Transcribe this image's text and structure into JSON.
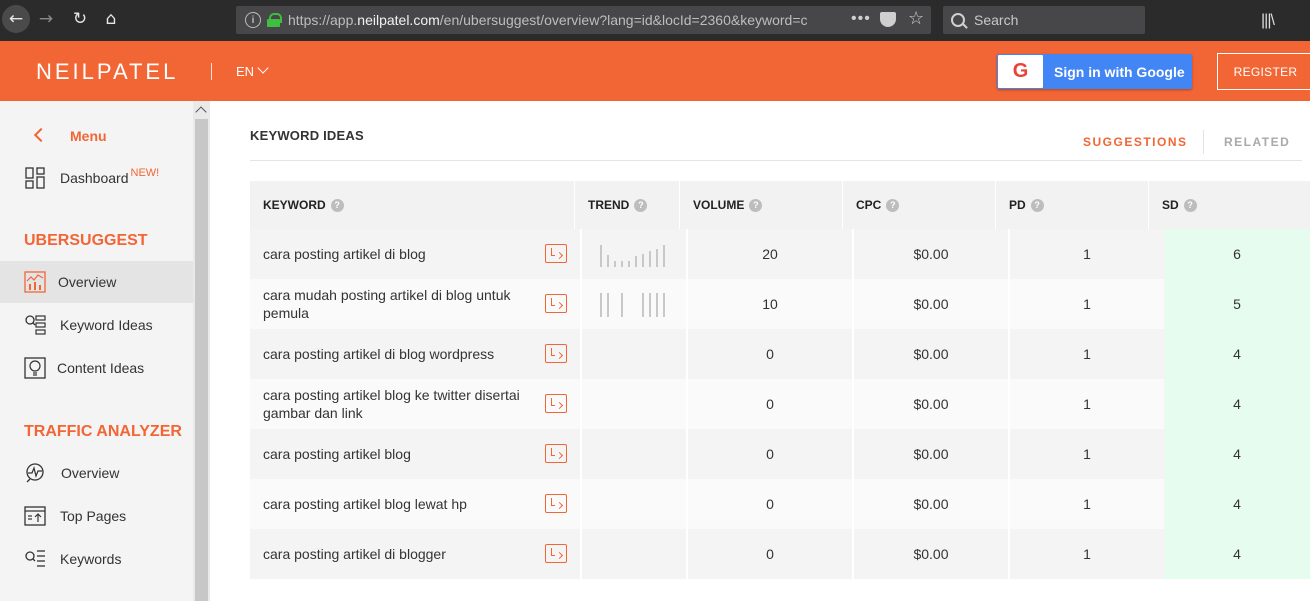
{
  "browser": {
    "url_prefix": "https://app.",
    "url_host": "neilpatel.com",
    "url_rest": "/en/ubersuggest/overview?lang=id&locId=2360&keyword=c",
    "search_placeholder": "Search",
    "more_label": "•••"
  },
  "header": {
    "logo": "NEILPATEL",
    "language": "EN",
    "google_button": "Sign in with Google",
    "register_button": "REGISTER"
  },
  "sidebar": {
    "menu_label": "Menu",
    "dashboard": "Dashboard",
    "new_badge": "NEW!",
    "section_ubersuggest": "UBERSUGGEST",
    "ubersuggest_items": [
      "Overview",
      "Keyword Ideas",
      "Content Ideas"
    ],
    "section_traffic": "TRAFFIC ANALYZER",
    "traffic_items": [
      "Overview",
      "Top Pages",
      "Keywords"
    ]
  },
  "main": {
    "title": "KEYWORD IDEAS",
    "tab_suggestions": "SUGGESTIONS",
    "tab_related": "RELATED",
    "columns": [
      "KEYWORD",
      "TREND",
      "VOLUME",
      "CPC",
      "PD",
      "SD"
    ],
    "help_glyph": "?",
    "rows": [
      {
        "keyword": "cara posting artikel di blog",
        "trend": [
          0.9,
          0.5,
          0.25,
          0.25,
          0.25,
          0.45,
          0.55,
          0.65,
          0.75,
          0.9
        ],
        "volume": "20",
        "cpc": "$0.00",
        "pd": "1",
        "sd": "6"
      },
      {
        "keyword": "cara mudah posting artikel di blog untuk pemula",
        "trend": [
          1,
          1,
          0,
          1,
          0,
          0,
          1,
          1,
          1,
          1
        ],
        "volume": "10",
        "cpc": "$0.00",
        "pd": "1",
        "sd": "5"
      },
      {
        "keyword": "cara posting artikel di blog wordpress",
        "trend": [],
        "volume": "0",
        "cpc": "$0.00",
        "pd": "1",
        "sd": "4"
      },
      {
        "keyword": "cara posting artikel blog ke twitter disertai gambar dan link",
        "trend": [],
        "volume": "0",
        "cpc": "$0.00",
        "pd": "1",
        "sd": "4"
      },
      {
        "keyword": "cara posting artikel blog",
        "trend": [],
        "volume": "0",
        "cpc": "$0.00",
        "pd": "1",
        "sd": "4"
      },
      {
        "keyword": "cara posting artikel blog lewat hp",
        "trend": [],
        "volume": "0",
        "cpc": "$0.00",
        "pd": "1",
        "sd": "4"
      },
      {
        "keyword": "cara posting artikel di blogger",
        "trend": [],
        "volume": "0",
        "cpc": "$0.00",
        "pd": "1",
        "sd": "4"
      }
    ]
  },
  "colors": {
    "brand_orange": "#f26535",
    "google_blue": "#4285f4",
    "sd_green_bg": "#e6fcee"
  }
}
